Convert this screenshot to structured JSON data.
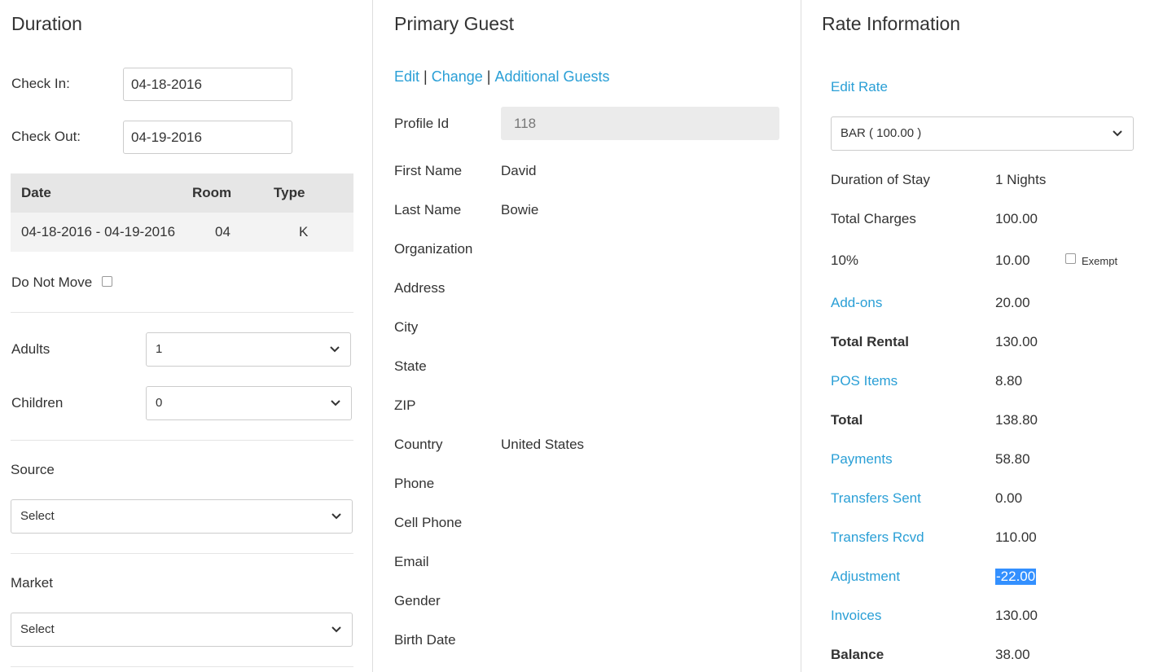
{
  "duration": {
    "title": "Duration",
    "check_in_label": "Check In:",
    "check_in_value": "04-18-2016",
    "check_out_label": "Check Out:",
    "check_out_value": "04-19-2016",
    "table": {
      "headers": [
        "Date",
        "Room",
        "Type"
      ],
      "rows": [
        {
          "date": "04-18-2016 - 04-19-2016",
          "room": "04",
          "type": "K"
        }
      ]
    },
    "do_not_move_label": "Do Not Move",
    "adults_label": "Adults",
    "adults_value": "1",
    "children_label": "Children",
    "children_value": "0",
    "source_label": "Source",
    "source_value": "Select",
    "market_label": "Market",
    "market_value": "Select"
  },
  "guest": {
    "title": "Primary Guest",
    "links": {
      "edit": "Edit",
      "change": "Change",
      "additional": "Additional Guests",
      "separator": "|"
    },
    "profile_id_label": "Profile Id",
    "profile_id_value": "118",
    "fields": [
      {
        "label": "First Name",
        "value": "David"
      },
      {
        "label": "Last Name",
        "value": "Bowie"
      },
      {
        "label": "Organization",
        "value": ""
      },
      {
        "label": "Address",
        "value": ""
      },
      {
        "label": "City",
        "value": ""
      },
      {
        "label": "State",
        "value": ""
      },
      {
        "label": "ZIP",
        "value": ""
      },
      {
        "label": "Country",
        "value": "United States"
      },
      {
        "label": "Phone",
        "value": ""
      },
      {
        "label": "Cell Phone",
        "value": ""
      },
      {
        "label": "Email",
        "value": ""
      },
      {
        "label": "Gender",
        "value": ""
      },
      {
        "label": "Birth Date",
        "value": ""
      }
    ]
  },
  "rate": {
    "title": "Rate Information",
    "edit_rate": "Edit Rate",
    "rate_select": "BAR ( 100.00 )",
    "exempt_label": "Exempt",
    "rows": [
      {
        "label": "Duration of Stay",
        "value": "1 Nights"
      },
      {
        "label": "Total Charges",
        "value": "100.00"
      },
      {
        "label": "10%",
        "value": "10.00"
      },
      {
        "label": "Add-ons",
        "value": "20.00"
      },
      {
        "label": "Total Rental",
        "value": "130.00"
      },
      {
        "label": "POS Items",
        "value": "8.80"
      },
      {
        "label": "Total",
        "value": "138.80"
      },
      {
        "label": "Payments",
        "value": "58.80"
      },
      {
        "label": "Transfers Sent",
        "value": "0.00"
      },
      {
        "label": "Transfers Rcvd",
        "value": "110.00"
      },
      {
        "label": "Adjustment",
        "value": "-22.00"
      },
      {
        "label": "Invoices",
        "value": "130.00"
      },
      {
        "label": "Balance",
        "value": "38.00"
      }
    ]
  },
  "colors": {
    "link": "#2a9fd6",
    "highlight": "#3390ff"
  }
}
